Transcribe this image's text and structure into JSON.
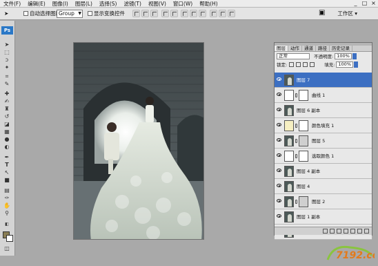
{
  "menu": {
    "items": [
      "文件(F)",
      "编辑(E)",
      "图像(I)",
      "图层(L)",
      "选择(S)",
      "滤镜(T)",
      "视图(V)",
      "窗口(W)",
      "帮助(H)"
    ],
    "window_controls": [
      "_",
      "□",
      "×"
    ]
  },
  "options": {
    "auto_select_label": "自动选择图层",
    "auto_select_value": "Group",
    "show_transform_label": "显示变换控件",
    "workspace_label": "工作区 ▾"
  },
  "toolbox": {
    "logo": "Ps",
    "tools": [
      "move-tool",
      "marquee-tool",
      "lasso-tool",
      "magic-wand-tool",
      "crop-tool",
      "eyedropper-tool",
      "healing-tool",
      "brush-tool",
      "stamp-tool",
      "history-brush-tool",
      "eraser-tool",
      "gradient-tool",
      "blur-tool",
      "dodge-tool",
      "pen-tool",
      "type-tool",
      "path-select-tool",
      "shape-tool",
      "notes-tool",
      "hand-tool",
      "zoom-tool"
    ],
    "foreground_color": "#8a7e55",
    "background_color": "#ffffff"
  },
  "layers_panel": {
    "tabs": [
      "图层",
      "动作",
      "通道",
      "路径",
      "历史记录"
    ],
    "blend_mode": "正常",
    "opacity_label": "不透明度:",
    "opacity_value": "100%",
    "lock_label": "锁定:",
    "fill_label": "填充:",
    "fill_value": "100%",
    "layers": [
      {
        "name": "图层 7",
        "thumb": "portrait",
        "selected": true
      },
      {
        "name": "曲线 1",
        "thumb": "adjust",
        "mask": true
      },
      {
        "name": "图层 6 副本",
        "thumb": "portrait"
      },
      {
        "name": "颜色填充 1",
        "thumb": "fill",
        "mask": true
      },
      {
        "name": "图层 5",
        "thumb": "portrait",
        "mask": true
      },
      {
        "name": "选取颜色 1",
        "thumb": "adjust",
        "mask": true
      },
      {
        "name": "图层 4 副本",
        "thumb": "portrait"
      },
      {
        "name": "图层 4",
        "thumb": "portrait"
      },
      {
        "name": "图层 2",
        "thumb": "portrait",
        "mask": true
      },
      {
        "name": "图层 1 副本",
        "thumb": "portrait"
      },
      {
        "name": "图层 1",
        "thumb": "portrait"
      }
    ],
    "bottom_icons": [
      "link-layers-icon",
      "fx-icon",
      "mask-icon",
      "adjustment-icon",
      "group-icon",
      "new-layer-icon",
      "trash-icon"
    ]
  },
  "watermark": {
    "text": "7192.com"
  }
}
